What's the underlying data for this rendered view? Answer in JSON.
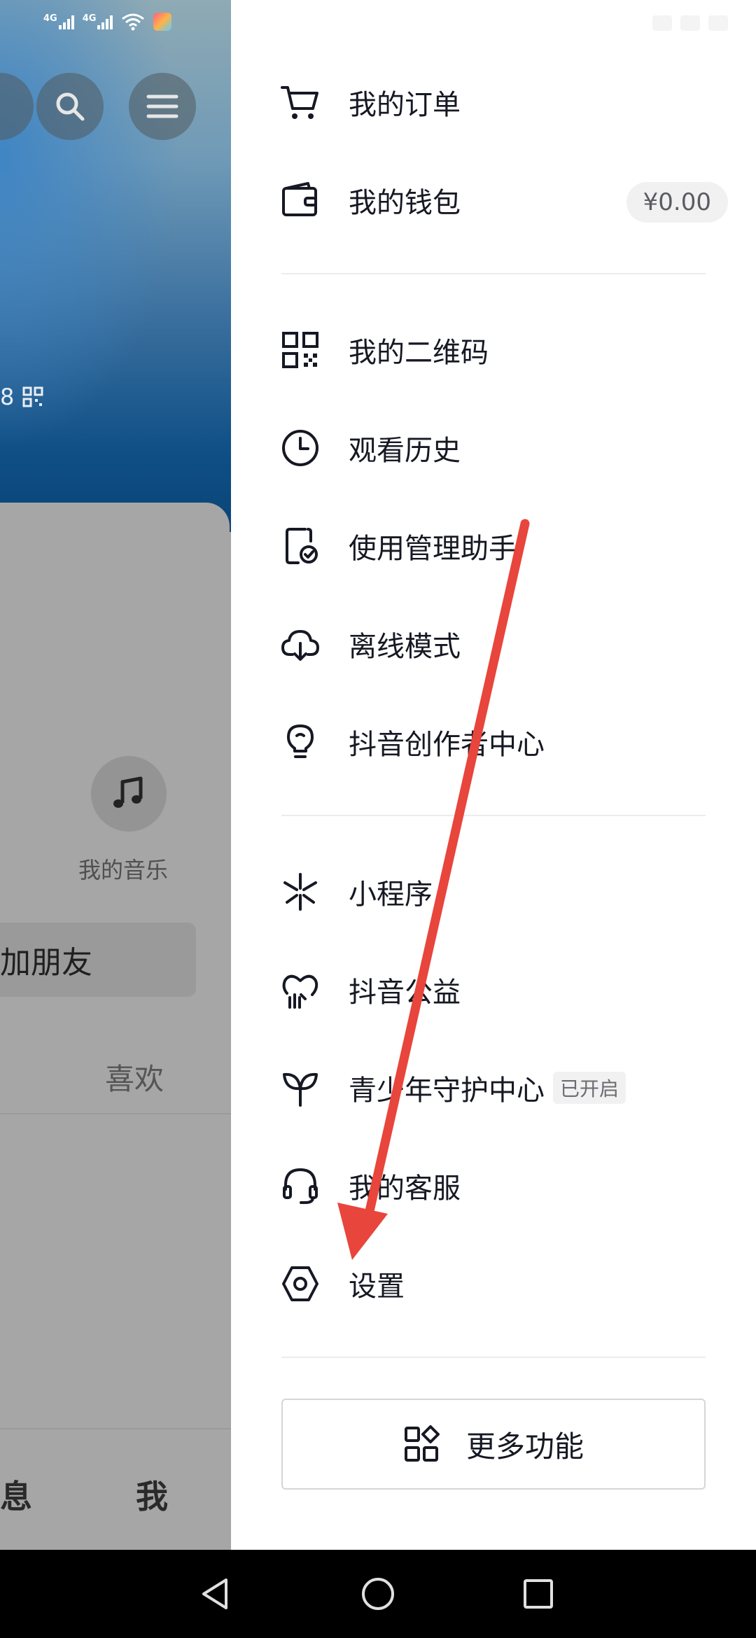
{
  "background_page": {
    "stat_text": "8",
    "music_label": "我的音乐",
    "add_friend_label": "加朋友",
    "likes_tab_label": "喜欢",
    "bottom_nav": {
      "messages_label": "息",
      "me_label": "我"
    }
  },
  "status_bar": {
    "network_1": "4G",
    "network_2": "4G"
  },
  "drawer": {
    "section_1": [
      {
        "name": "my-orders",
        "icon": "cart-icon",
        "label": "我的订单"
      },
      {
        "name": "my-wallet",
        "icon": "wallet-icon",
        "label": "我的钱包",
        "badge": "¥0.00"
      }
    ],
    "section_2": [
      {
        "name": "my-qr-code",
        "icon": "qr-code-icon",
        "label": "我的二维码"
      },
      {
        "name": "watch-history",
        "icon": "clock-icon",
        "label": "观看历史"
      },
      {
        "name": "usage-manager",
        "icon": "phone-check-icon",
        "label": "使用管理助手"
      },
      {
        "name": "offline-mode",
        "icon": "cloud-download-icon",
        "label": "离线模式"
      },
      {
        "name": "creator-center",
        "icon": "lightbulb-icon",
        "label": "抖音创作者中心"
      }
    ],
    "section_3": [
      {
        "name": "mini-programs",
        "icon": "asterisk-icon",
        "label": "小程序"
      },
      {
        "name": "douyin-charity",
        "icon": "heart-hand-icon",
        "label": "抖音公益"
      },
      {
        "name": "youth-protection",
        "icon": "sprout-icon",
        "label": "青少年守护中心",
        "badge": "已开启"
      },
      {
        "name": "customer-service",
        "icon": "headset-icon",
        "label": "我的客服"
      },
      {
        "name": "settings",
        "icon": "hexagon-gear-icon",
        "label": "设置"
      }
    ],
    "more_button_label": "更多功能"
  },
  "colors": {
    "annotation_arrow": "#e8453c",
    "text_primary": "#161823"
  }
}
